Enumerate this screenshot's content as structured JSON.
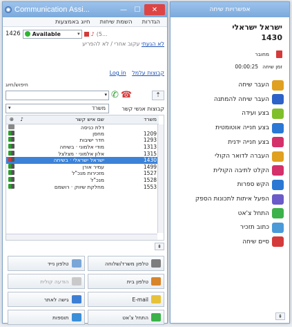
{
  "left_window": {
    "title": "Communication Assi...",
    "menu": [
      "הגדרות",
      "השמת שיחות",
      "חיוג באמצעות"
    ],
    "extension": "1426",
    "presence": "Available",
    "presence_extra": "(5...",
    "not_available": "לא הגעתי",
    "back_soon": "עקוב אחרי / לא להפריע",
    "not_disturb": "לא להפריע",
    "login": "Log in",
    "login_groups": "קבוצות עלמל",
    "search_label": "חיפוש/חיוג",
    "filter_value": "משרד",
    "filter_label": "קבוצות אנשי קשר",
    "table": {
      "headers": [
        "שם איש קשר",
        "משרד"
      ],
      "rows": [
        {
          "name": "דלת כניסה",
          "ext": "",
          "status": "p"
        },
        {
          "name": "מחסן",
          "ext": "1209",
          "status": "g"
        },
        {
          "name": "חדר ישיבות",
          "ext": "1293",
          "status": "g"
        },
        {
          "name": "מודי אלמוני · בשיחה",
          "ext": "1313",
          "status": "g"
        },
        {
          "name": "אלון אלמוני · מצלצל",
          "ext": "1315",
          "status": "g"
        },
        {
          "name": "ישראל ישראלי · בשיחה",
          "ext": "1430",
          "status": "r",
          "selected": true
        },
        {
          "name": "עמיר אורן",
          "ext": "1499",
          "status": "g"
        },
        {
          "name": "מזכירות מנכ\"ל",
          "ext": "1527",
          "status": "g"
        },
        {
          "name": "מנכ\"ל",
          "ext": "1528",
          "status": "g"
        },
        {
          "name": "מחלקת שיווק · רושמם",
          "ext": "1553",
          "status": "g"
        }
      ]
    },
    "buttons": [
      {
        "label": "טלפון נייד",
        "icon": "mobile-phone-icon",
        "color": "#7aa7d8",
        "disabled": false
      },
      {
        "label": "טלפון משרד/שלוחה",
        "icon": "office-phone-icon",
        "color": "#7d7d7d",
        "disabled": false
      },
      {
        "label": "הודעה קולית",
        "icon": "voicemail-icon",
        "color": "#c9c9c9",
        "disabled": true
      },
      {
        "label": "טלפון בית",
        "icon": "home-phone-icon",
        "color": "#d8842a",
        "disabled": false
      },
      {
        "label": "גישה לאתר",
        "icon": "website-icon",
        "color": "#3d7fd4",
        "disabled": false
      },
      {
        "label": "E-mail",
        "icon": "email-icon",
        "color": "#e6c23a",
        "disabled": false
      },
      {
        "label": "תוספות",
        "icon": "addons-icon",
        "color": "#3a8fd8",
        "disabled": false
      },
      {
        "label": "התחל צ'אט",
        "icon": "chat-icon",
        "color": "#3bb24a",
        "disabled": false
      }
    ]
  },
  "right_panel": {
    "title": "אפשרויות שיחה",
    "caller_name": "ישראל ישראלי",
    "caller_number": "1430",
    "line_status": "מחובר",
    "time_label": "זמן שיחה",
    "time_value": "00:00:25",
    "actions": [
      {
        "label": "העבר שיחה",
        "icon": "transfer-call-icon",
        "color": "#e0a020"
      },
      {
        "label": "העבר שיחה להמתנה",
        "icon": "hold-call-icon",
        "color": "#2d62c8"
      },
      {
        "label": "בצע ועידה",
        "icon": "conference-icon",
        "color": "#7fbf2a"
      },
      {
        "label": "בצע חנייה אוטומטית",
        "icon": "auto-park-icon",
        "color": "#2a78d4"
      },
      {
        "label": "בצע חנייה ידנית",
        "icon": "manual-park-icon",
        "color": "#d4306a"
      },
      {
        "label": "העברה לדואר הקולי",
        "icon": "voicemail-transfer-icon",
        "color": "#e0a020"
      },
      {
        "label": "הקלט לתיבה הקולית",
        "icon": "record-icon",
        "color": "#d4306a"
      },
      {
        "label": "הקש ספרות",
        "icon": "dialpad-icon",
        "color": "#2a78d4"
      },
      {
        "label": "הפעל איתות לתכונות הספק",
        "icon": "signal-icon",
        "color": "#6a5bc8"
      },
      {
        "label": "התחל צ'אט",
        "icon": "chat-icon",
        "color": "#3bb24a"
      },
      {
        "label": "כתוב תזכיר",
        "icon": "memo-icon",
        "color": "#4a9ad8"
      },
      {
        "label": "סיים שיחה",
        "icon": "hangup-icon",
        "color": "#d43a3a"
      }
    ]
  }
}
